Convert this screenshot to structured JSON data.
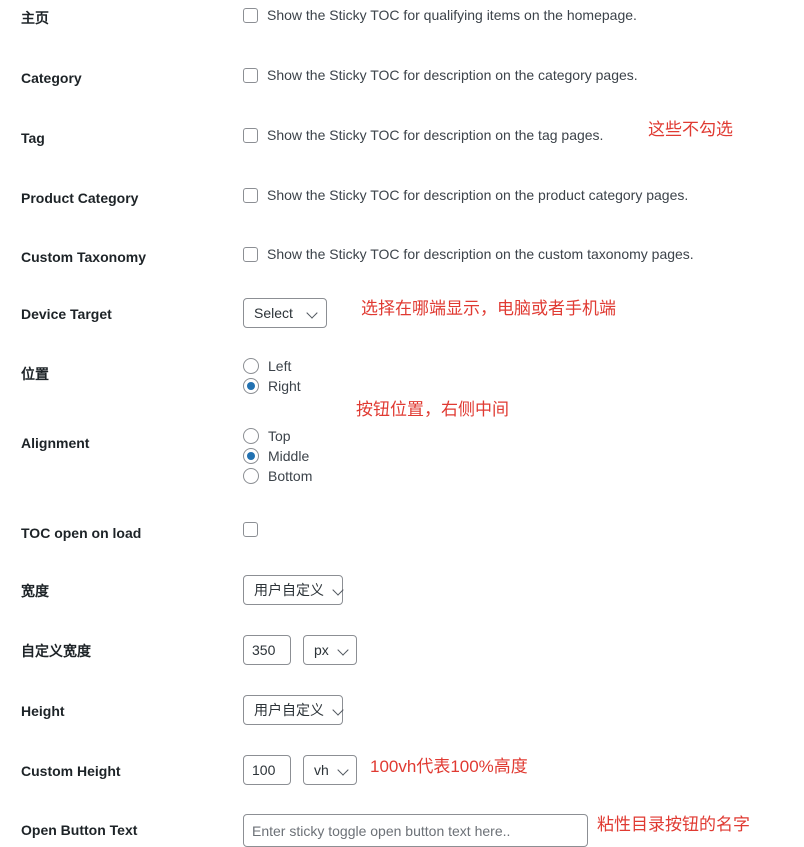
{
  "rows": [
    {
      "label": "主页",
      "type": "checkbox",
      "checkbox_label": "Show the Sticky TOC for qualifying items on the homepage.",
      "checked": false
    },
    {
      "label": "Category",
      "type": "checkbox",
      "checkbox_label": "Show the Sticky TOC for description on the category pages.",
      "checked": false
    },
    {
      "label": "Tag",
      "type": "checkbox",
      "checkbox_label": "Show the Sticky TOC for description on the tag pages.",
      "checked": false
    },
    {
      "label": "Product Category",
      "type": "checkbox",
      "checkbox_label": "Show the Sticky TOC for description on the product category pages.",
      "checked": false
    },
    {
      "label": "Custom Taxonomy",
      "type": "checkbox",
      "checkbox_label": "Show the Sticky TOC for description on the custom taxonomy pages.",
      "checked": false
    },
    {
      "label": "Device Target",
      "type": "select",
      "value": "Select"
    },
    {
      "label": "位置",
      "type": "radio",
      "options": [
        "Left",
        "Right"
      ],
      "selected": "Right"
    },
    {
      "label": "Alignment",
      "type": "radio",
      "options": [
        "Top",
        "Middle",
        "Bottom"
      ],
      "selected": "Middle"
    },
    {
      "label": "TOC open on load",
      "type": "checkbox",
      "checkbox_label": "",
      "checked": false
    },
    {
      "label": "宽度",
      "type": "select",
      "value": "用户自定义"
    },
    {
      "label": "自定义宽度",
      "type": "number-unit",
      "value": "350",
      "unit": "px"
    },
    {
      "label": "Height",
      "type": "select",
      "value": "用户自定义"
    },
    {
      "label": "Custom Height",
      "type": "number-unit",
      "value": "100",
      "unit": "vh"
    },
    {
      "label": "Open Button Text",
      "type": "text",
      "value": "",
      "placeholder": "Enter sticky toggle open button text here.."
    }
  ],
  "annotations": [
    {
      "text": "这些不勾选"
    },
    {
      "text": "选择在哪端显示，电脑或者手机端"
    },
    {
      "text": "按钮位置，右侧中间"
    },
    {
      "text": "100vh代表100%高度"
    },
    {
      "text": "粘性目录按钮的名字"
    }
  ],
  "colors": {
    "annotation_red": "#e03a32",
    "radio_blue": "#2271b1",
    "label_text": "#1d2327"
  }
}
